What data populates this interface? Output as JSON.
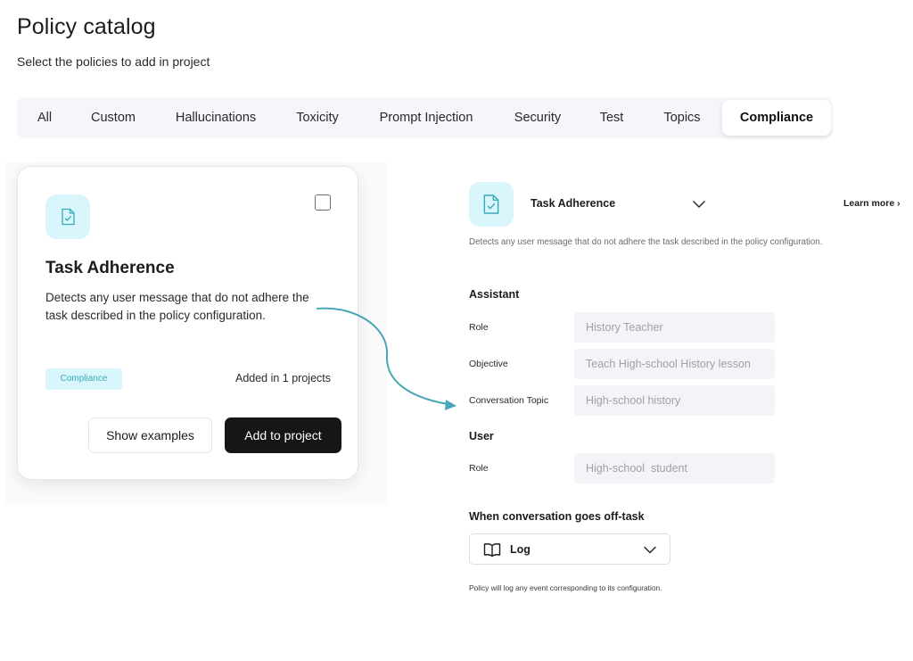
{
  "page": {
    "title": "Policy catalog",
    "subtitle": "Select the policies to add in project"
  },
  "tabs": [
    {
      "label": "All",
      "active": false
    },
    {
      "label": "Custom",
      "active": false
    },
    {
      "label": "Hallucinations",
      "active": false
    },
    {
      "label": "Toxicity",
      "active": false
    },
    {
      "label": "Prompt Injection",
      "active": false
    },
    {
      "label": "Security",
      "active": false
    },
    {
      "label": "Test",
      "active": false
    },
    {
      "label": "Topics",
      "active": false
    },
    {
      "label": "Compliance",
      "active": true
    }
  ],
  "card": {
    "icon": "document-check-icon",
    "title": "Task Adherence",
    "description": "Detects any user message that do not adhere the task described in the policy configuration.",
    "tag": "Compliance",
    "added_count": "Added in 1 projects",
    "show_examples_label": "Show examples",
    "add_to_project_label": "Add to project",
    "checked": false
  },
  "panel": {
    "icon": "document-check-icon",
    "policy_name": "Task Adherence",
    "learn_more": "Learn more ›",
    "description": "Detects any user message that do not adhere the task described in the policy configuration.",
    "assistant": {
      "heading": "Assistant",
      "role_label": "Role",
      "role_value": "History Teacher",
      "objective_label": "Objective",
      "objective_value": "Teach High-school History lesson",
      "topic_label": "Conversation Topic",
      "topic_value": "High-school history"
    },
    "user": {
      "heading": "User",
      "role_label": "Role",
      "role_value": "High-school  student"
    },
    "off_task": {
      "heading": "When conversation goes off-task",
      "action_icon": "book-icon",
      "action": "Log",
      "note": "Policy will log any event corresponding to its configuration."
    }
  },
  "colors": {
    "accent_tile": "#d8f6fb",
    "accent_icon": "#3aa9b9",
    "arrow": "#4aa7b8",
    "primary_button": "#161616",
    "tabs_background": "#f5f5fa"
  }
}
